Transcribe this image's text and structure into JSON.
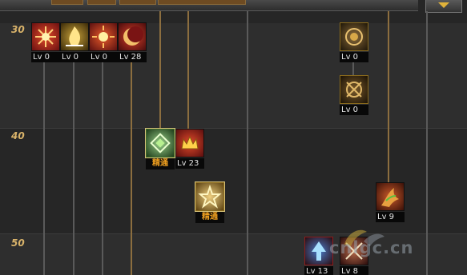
{
  "header": {
    "dropdown_icon": "chevron-down-icon"
  },
  "rows": [
    {
      "level_label": "30"
    },
    {
      "level_label": "40"
    },
    {
      "level_label": "50"
    }
  ],
  "skills": [
    {
      "icon": "red-starburst-icon",
      "level": "Lv 0",
      "state": "locked",
      "border_color": "#8a1c1c"
    },
    {
      "icon": "gold-flame-icon",
      "level": "Lv 0",
      "state": "locked",
      "border_color": "#8a6a1c"
    },
    {
      "icon": "red-sun-icon",
      "level": "Lv 0",
      "state": "locked",
      "border_color": "#8a1c1c"
    },
    {
      "icon": "red-crescent-icon",
      "level": "Lv 28",
      "state": "learned",
      "border_color": "#8a1c1c"
    },
    {
      "icon": "gold-orb-icon",
      "level": "Lv 0",
      "state": "locked",
      "border_color": "#8a6a1c"
    },
    {
      "icon": "gold-rune-icon",
      "level": "Lv 0",
      "state": "locked",
      "border_color": "#8a6a1c"
    },
    {
      "icon": "green-diamond-icon",
      "level": "精通",
      "state": "mastery",
      "border_color": "#3d6b2a"
    },
    {
      "icon": "crown-icon",
      "level": "Lv 23",
      "state": "learned",
      "border_color": "#8a1c1c"
    },
    {
      "icon": "gold-star-icon",
      "level": "精通",
      "state": "mastery",
      "border_color": "#8a6a1c"
    },
    {
      "icon": "dragon-claw-icon",
      "level": "Lv 9",
      "state": "learned",
      "border_color": "#8a1c1c"
    },
    {
      "icon": "arrow-up-icon",
      "level": "Lv 13",
      "state": "learned",
      "border_color": "#8a1c1c"
    },
    {
      "icon": "twin-swords-icon",
      "level": "Lv 8",
      "state": "learned",
      "border_color": "#8a1c1c"
    }
  ],
  "watermark": {
    "text": "cnlgc.cn",
    "logo": "leaf-logo-icon"
  }
}
